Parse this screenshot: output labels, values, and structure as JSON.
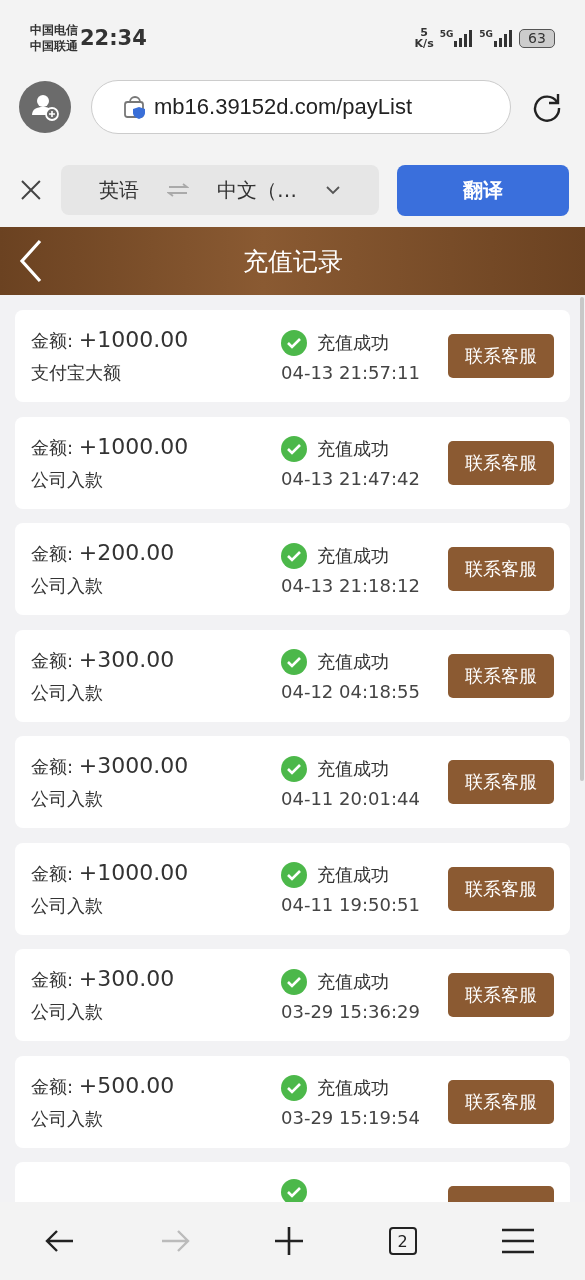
{
  "status_bar": {
    "carriers": [
      "中国电信",
      "中国联通"
    ],
    "time": "22:34",
    "speed_value": "5",
    "speed_unit": "K/s",
    "networks": [
      "5G",
      "5G"
    ],
    "battery": "63"
  },
  "browser": {
    "url": "mb16.39152d.com/payList"
  },
  "translate_bar": {
    "source": "英语",
    "target": "中文（…",
    "button": "翻译"
  },
  "header": {
    "title": "充值记录"
  },
  "records": [
    {
      "amount_label": "金额:",
      "amount": "+1000.00",
      "method": "支付宝大额",
      "status": "充值成功",
      "time": "04-13 21:57:11",
      "button": "联系客服"
    },
    {
      "amount_label": "金额:",
      "amount": "+1000.00",
      "method": "公司入款",
      "status": "充值成功",
      "time": "04-13 21:47:42",
      "button": "联系客服"
    },
    {
      "amount_label": "金额:",
      "amount": "+200.00",
      "method": "公司入款",
      "status": "充值成功",
      "time": "04-13 21:18:12",
      "button": "联系客服"
    },
    {
      "amount_label": "金额:",
      "amount": "+300.00",
      "method": "公司入款",
      "status": "充值成功",
      "time": "04-12 04:18:55",
      "button": "联系客服"
    },
    {
      "amount_label": "金额:",
      "amount": "+3000.00",
      "method": "公司入款",
      "status": "充值成功",
      "time": "04-11 20:01:44",
      "button": "联系客服"
    },
    {
      "amount_label": "金额:",
      "amount": "+1000.00",
      "method": "公司入款",
      "status": "充值成功",
      "time": "04-11 19:50:51",
      "button": "联系客服"
    },
    {
      "amount_label": "金额:",
      "amount": "+300.00",
      "method": "公司入款",
      "status": "充值成功",
      "time": "03-29 15:36:29",
      "button": "联系客服"
    },
    {
      "amount_label": "金额:",
      "amount": "+500.00",
      "method": "公司入款",
      "status": "充值成功",
      "time": "03-29 15:19:54",
      "button": "联系客服"
    },
    {
      "kind": "partial"
    }
  ],
  "bottom_nav": {
    "tab_count": "2",
    "forward_disabled": true
  }
}
